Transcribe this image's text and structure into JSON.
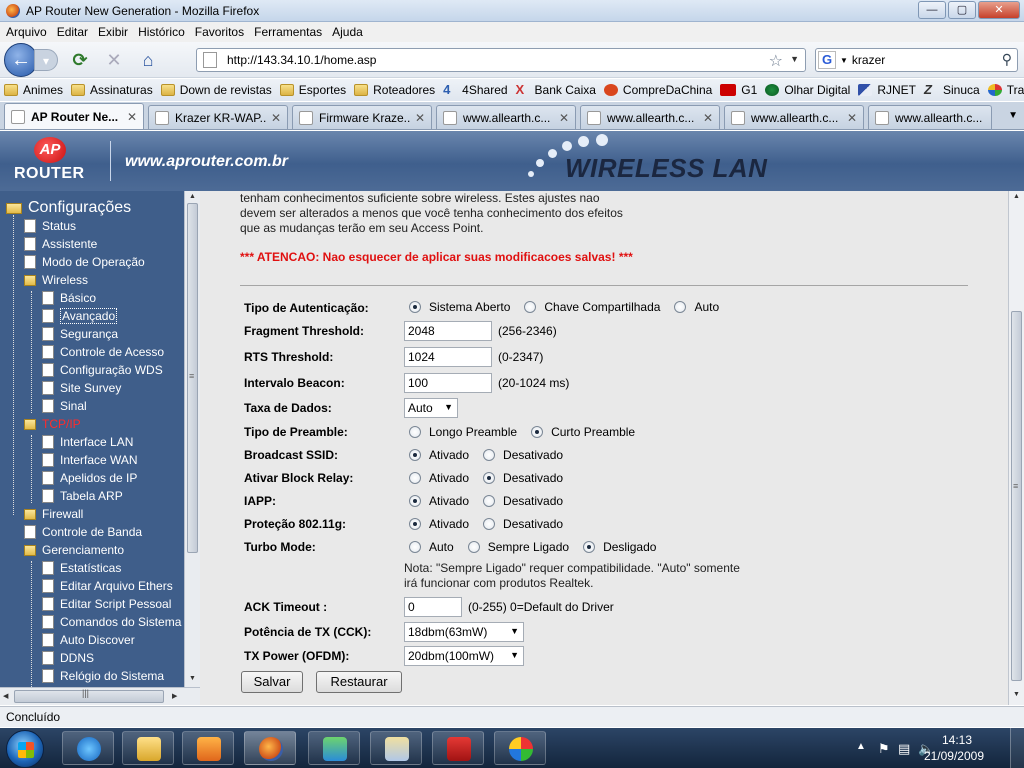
{
  "window": {
    "title": "AP Router New Generation - Mozilla Firefox",
    "min": "—",
    "max": "▢",
    "close": "✕"
  },
  "menu": [
    "Arquivo",
    "Editar",
    "Exibir",
    "Histórico",
    "Favoritos",
    "Ferramentas",
    "Ajuda"
  ],
  "nav": {
    "url": "http://143.34.10.1/home.asp",
    "search": "krazer"
  },
  "bookmarks": [
    "Animes",
    "Assinaturas",
    "Down de revistas",
    "Esportes",
    "Roteadores",
    "4Shared",
    "Bank Caixa",
    "CompreDaChina",
    "G1",
    "Olhar Digital",
    "RJNET",
    "Sinuca",
    "Tradutor"
  ],
  "tabs": [
    "AP Router Ne...",
    "Krazer KR-WAP...",
    "Firmware Kraze...",
    "www.allearth.c...",
    "www.allearth.c...",
    "www.allearth.c...",
    "www.allearth.c..."
  ],
  "header": {
    "logo_ap": "AP",
    "logo_router": "ROUTER",
    "url": "www.aprouter.com.br",
    "wireless": "WIRELESS LAN"
  },
  "sidebar": {
    "root": "Configurações",
    "items": [
      "Status",
      "Assistente",
      "Modo de Operação",
      "Wireless",
      "Básico",
      "Avançado",
      "Segurança",
      "Controle de Acesso",
      "Configuração WDS",
      "Site Survey",
      "Sinal",
      "TCP/IP",
      "Interface LAN",
      "Interface WAN",
      "Apelidos de IP",
      "Tabela ARP",
      "Firewall",
      "Controle de Banda",
      "Gerenciamento",
      "Estatísticas",
      "Editar Arquivo Ethers",
      "Editar Script Pessoal",
      "Comandos do Sistema",
      "Auto Discover",
      "DDNS",
      "Relógio do Sistema"
    ]
  },
  "intro": {
    "line1": "tenham conhecimentos suficiente sobre wireless. Estes ajustes nao",
    "line2": "devem ser alterados a menos que você tenha conhecimento dos efeitos",
    "line3": "que as mudanças terão em seu Access Point."
  },
  "warning": "*** ATENCAO: Nao esquecer de aplicar suas modificacoes salvas! ***",
  "form": {
    "auth": {
      "label": "Tipo de Autenticação:",
      "opt1": "Sistema Aberto",
      "opt2": "Chave Compartilhada",
      "opt3": "Auto"
    },
    "frag": {
      "label": "Fragment Threshold:",
      "value": "2048",
      "hint": "(256-2346)"
    },
    "rts": {
      "label": "RTS Threshold:",
      "value": "1024",
      "hint": "(0-2347)"
    },
    "beacon": {
      "label": "Intervalo Beacon:",
      "value": "100",
      "hint": "(20-1024 ms)"
    },
    "rate": {
      "label": "Taxa de Dados:",
      "value": "Auto"
    },
    "preamble": {
      "label": "Tipo de Preamble:",
      "opt1": "Longo Preamble",
      "opt2": "Curto Preamble"
    },
    "bssid": {
      "label": "Broadcast SSID:",
      "opt1": "Ativado",
      "opt2": "Desativado"
    },
    "relay": {
      "label": "Ativar Block Relay:",
      "opt1": "Ativado",
      "opt2": "Desativado"
    },
    "iapp": {
      "label": "IAPP:",
      "opt1": "Ativado",
      "opt2": "Desativado"
    },
    "prot": {
      "label": "Proteção 802.11g:",
      "opt1": "Ativado",
      "opt2": "Desativado"
    },
    "turbo": {
      "label": "Turbo Mode:",
      "opt1": "Auto",
      "opt2": "Sempre Ligado",
      "opt3": "Desligado"
    },
    "note1": "Nota: \"Sempre Ligado\" requer compatibilidade. \"Auto\" somente",
    "note2": "irá funcionar com produtos Realtek.",
    "ack": {
      "label": "ACK Timeout :",
      "value": "0",
      "hint": "(0-255) 0=Default do Driver"
    },
    "cck": {
      "label": "Potência de TX (CCK):",
      "value": "18dbm(63mW)"
    },
    "ofdm": {
      "label": "TX Power (OFDM):",
      "value": "20dbm(100mW)"
    },
    "save": "Salvar",
    "reset": "Restaurar"
  },
  "status": "Concluído",
  "clock": {
    "time": "14:13",
    "date": "21/09/2009"
  }
}
